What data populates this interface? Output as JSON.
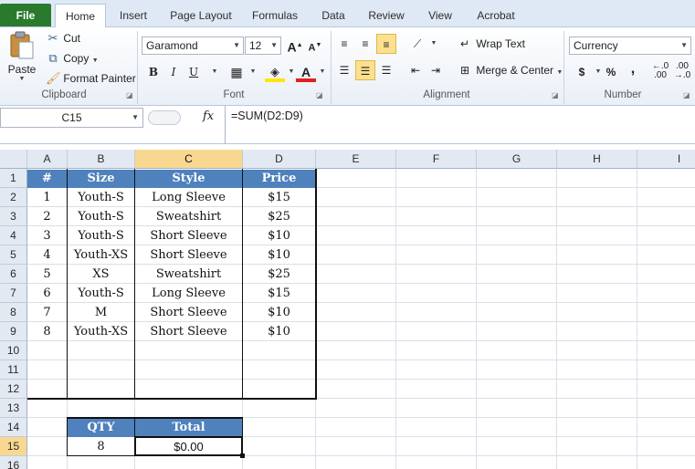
{
  "ribbon": {
    "tabs": [
      "File",
      "Home",
      "Insert",
      "Page Layout",
      "Formulas",
      "Data",
      "Review",
      "View",
      "Acrobat"
    ],
    "active_tab": "Home",
    "clipboard": {
      "paste": "Paste",
      "cut": "Cut",
      "copy": "Copy",
      "format_painter": "Format Painter",
      "label": "Clipboard"
    },
    "font": {
      "name": "Garamond",
      "size": "12",
      "label": "Font"
    },
    "alignment": {
      "wrap_text": "Wrap Text",
      "merge_center": "Merge & Center",
      "label": "Alignment"
    },
    "number": {
      "format": "Currency",
      "label": "Number",
      "currency_symbol": "$",
      "percent_symbol": "%",
      "comma_symbol": ","
    }
  },
  "formula_bar": {
    "name_box": "C15",
    "fx": "fx",
    "formula": "=SUM(D2:D9)"
  },
  "sheet": {
    "columns": [
      "A",
      "B",
      "C",
      "D",
      "E",
      "F",
      "G",
      "H",
      "I"
    ],
    "selected_column": "C",
    "rows": [
      "1",
      "2",
      "3",
      "4",
      "5",
      "6",
      "7",
      "8",
      "9",
      "10",
      "11",
      "12",
      "13",
      "14",
      "15",
      "16"
    ],
    "selected_row": "15",
    "table_headers": [
      "#",
      "Size",
      "Style",
      "Price"
    ],
    "table_rows": [
      [
        "1",
        "Youth-S",
        "Long Sleeve",
        "$15"
      ],
      [
        "2",
        "Youth-S",
        "Sweatshirt",
        "$25"
      ],
      [
        "3",
        "Youth-S",
        "Short Sleeve",
        "$10"
      ],
      [
        "4",
        "Youth-XS",
        "Short Sleeve",
        "$10"
      ],
      [
        "5",
        "XS",
        "Sweatshirt",
        "$25"
      ],
      [
        "6",
        "Youth-S",
        "Long Sleeve",
        "$15"
      ],
      [
        "7",
        "M",
        "Short Sleeve",
        "$10"
      ],
      [
        "8",
        "Youth-XS",
        "Short Sleeve",
        "$10"
      ]
    ],
    "summary_headers": [
      "QTY",
      "Total"
    ],
    "summary_values": [
      "8",
      "$0.00"
    ],
    "header_color": "#4f81bd"
  }
}
